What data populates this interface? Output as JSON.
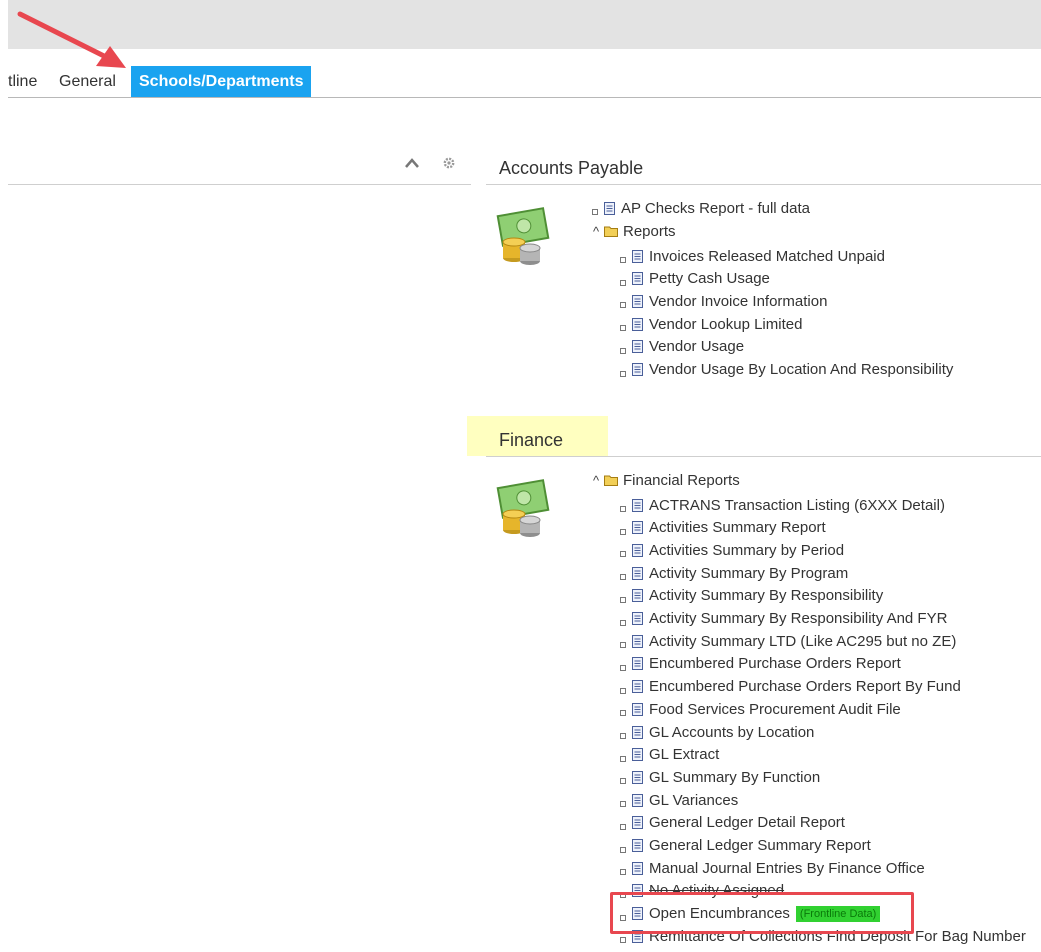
{
  "tabs": [
    {
      "label": "tline"
    },
    {
      "label": "General"
    },
    {
      "label": "Schools/Departments",
      "active": true
    }
  ],
  "panel_controls": {
    "collapse_icon": "chevron-up-icon",
    "settings_icon": "gear-icon"
  },
  "accounts_payable": {
    "title": "Accounts Payable",
    "top_item": "AP Checks Report - full data",
    "folder": "Reports",
    "items": [
      "Invoices Released Matched Unpaid",
      "Petty Cash Usage",
      "Vendor Invoice Information",
      "Vendor Lookup Limited",
      "Vendor Usage",
      "Vendor Usage By Location And Responsibility"
    ]
  },
  "finance": {
    "title": "Finance",
    "folder": "Financial Reports",
    "items": [
      "ACTRANS Transaction Listing (6XXX Detail)",
      "Activities Summary Report",
      "Activities Summary by Period",
      "Activity Summary By Program",
      "Activity Summary By Responsibility",
      "Activity Summary By Responsibility And FYR",
      "Activity Summary LTD (Like AC295 but no ZE)",
      "Encumbered Purchase Orders Report",
      "Encumbered Purchase Orders Report By Fund",
      "Food Services Procurement Audit File",
      "GL Accounts by Location",
      "GL Extract",
      "GL Summary By Function",
      "GL Variances",
      "General Ledger Detail Report",
      "General Ledger Summary Report",
      "Manual Journal Entries By Finance Office",
      "No Activity Assigned",
      "Open Encumbrances",
      "Remittance Of Collections Find Deposit For Bag Number"
    ],
    "highlight_badge": "(Frontline Data)"
  },
  "colors": {
    "active_tab": "#1aa3f0",
    "annotation_red": "#e8474f",
    "highlight_yellow": "#ffffc0",
    "badge_green": "#31d131"
  }
}
